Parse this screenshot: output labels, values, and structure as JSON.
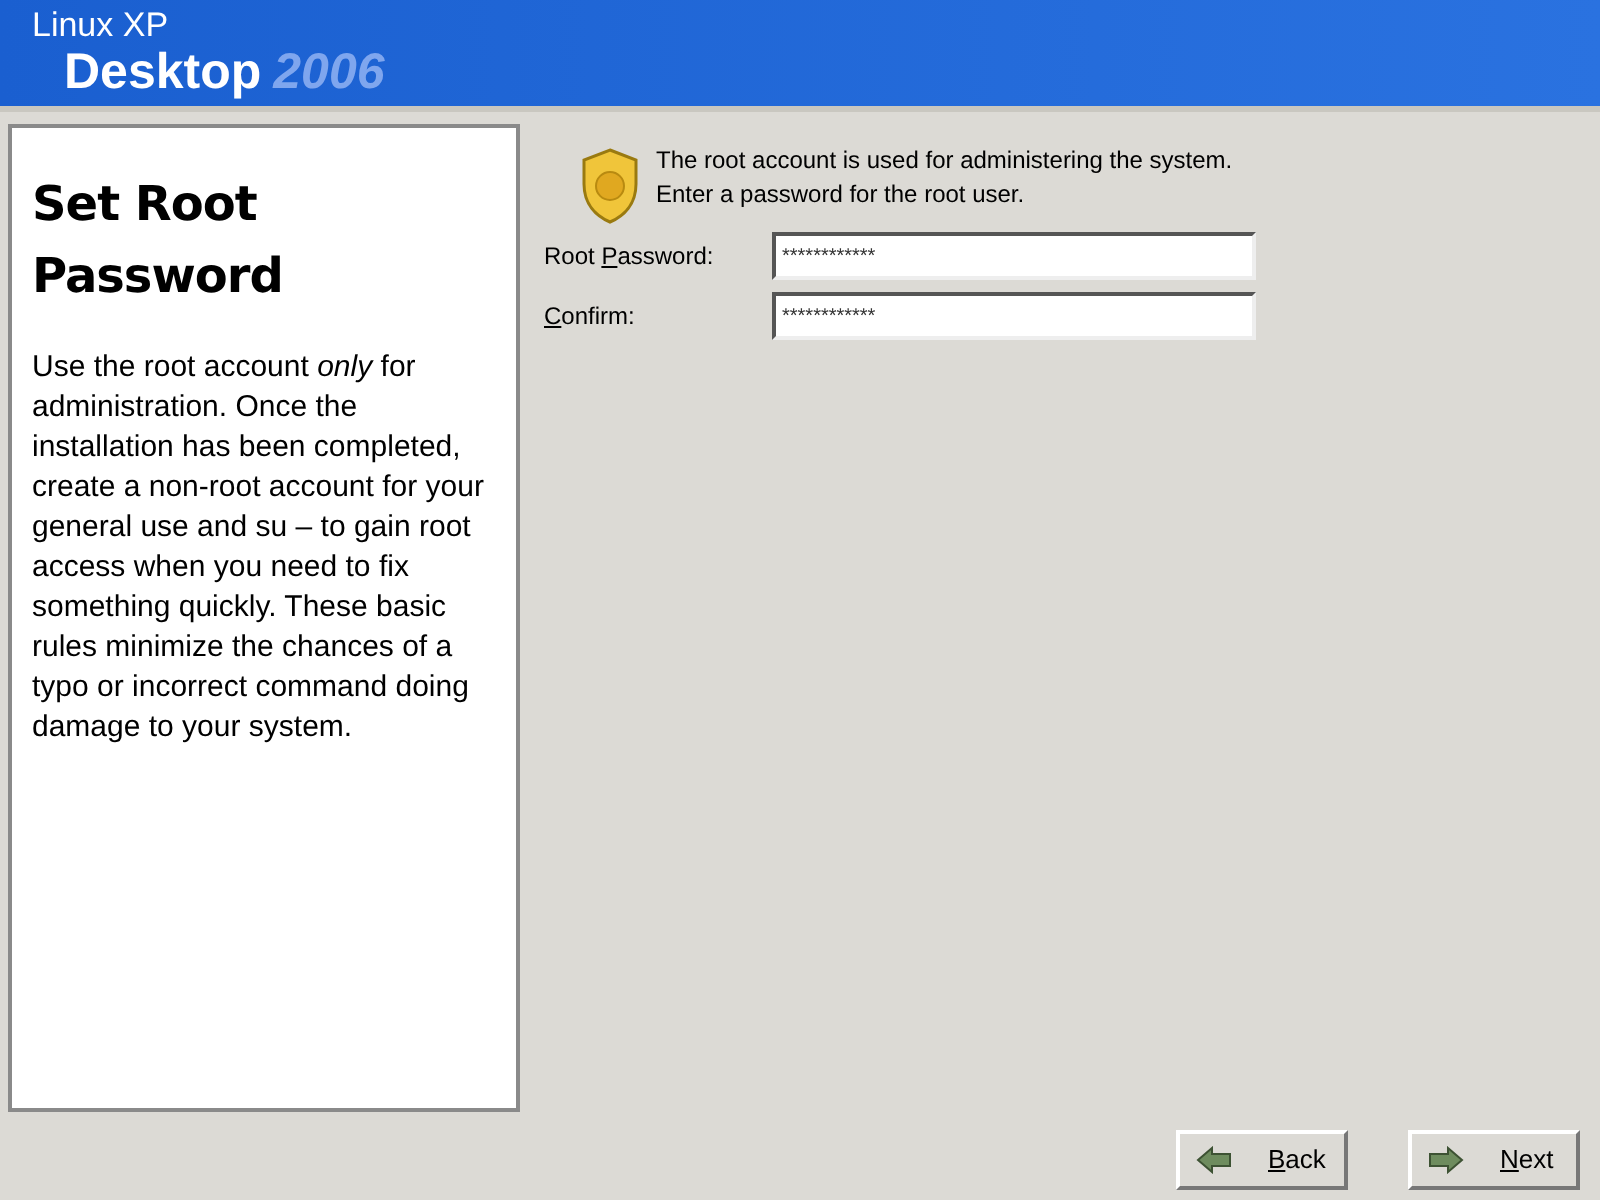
{
  "header": {
    "line1": "Linux XP",
    "product": "Desktop",
    "year": "2006"
  },
  "help": {
    "title": "Set Root Password",
    "body": "Use the root account *only* for administration. Once the installation has been completed, create a non-root account for your general use and su  – to gain root access when you need to fix something quickly. These basic rules minimize the chances of a typo or incorrect command doing damage to your system."
  },
  "intro": [
    "The root account is used for administering the system.",
    "Enter a password for the root user."
  ],
  "fields": [
    {
      "label": {
        "before": "Root ",
        "key": "P",
        "after": "assword:"
      },
      "value": "************"
    },
    {
      "label": {
        "key": "C",
        "after": "onfirm:"
      },
      "value": "************"
    }
  ],
  "buttons": [
    {
      "kind": "back",
      "label": {
        "key": "B",
        "after": "ack"
      }
    },
    {
      "kind": "next",
      "label": {
        "key": "N",
        "after": "ext"
      }
    }
  ]
}
